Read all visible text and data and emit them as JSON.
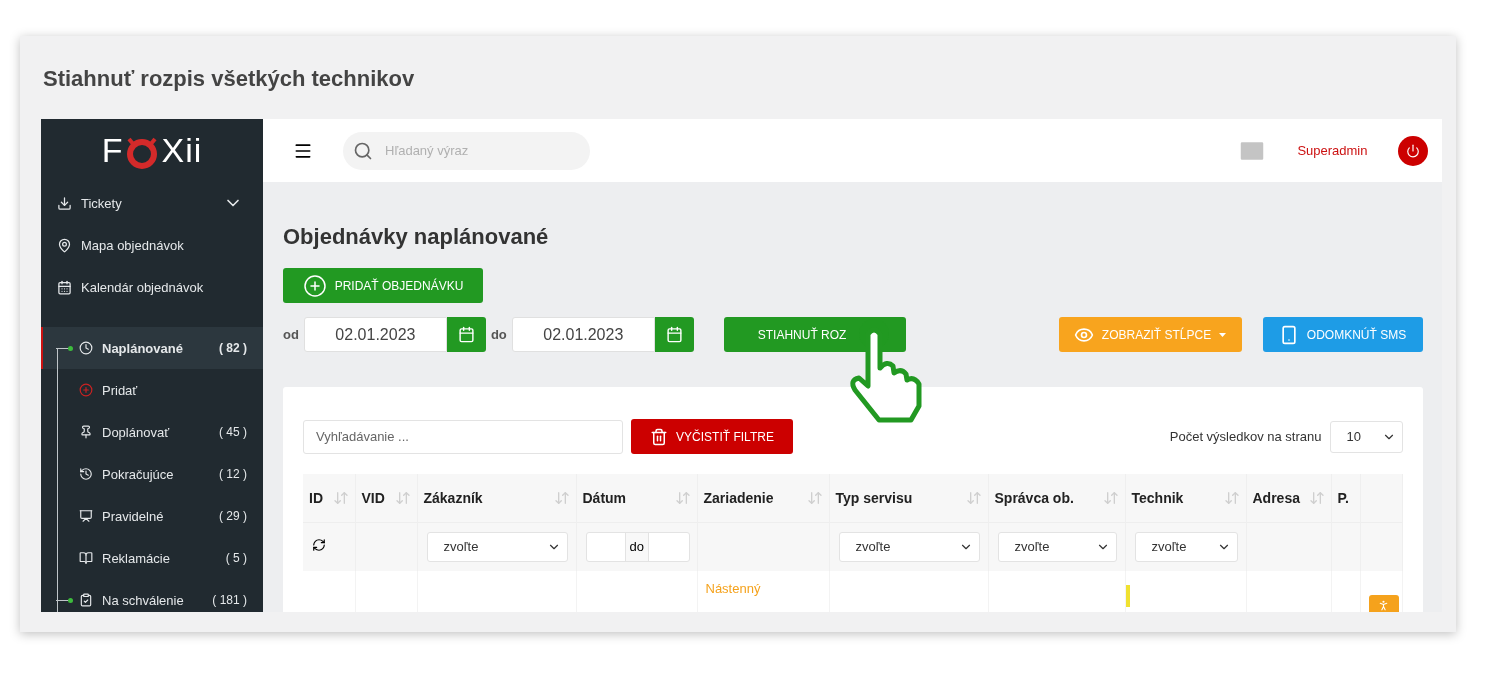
{
  "page_title": "Stiahnuť rozpis všetkých technikov",
  "logo": {
    "left": "F",
    "right": "Xii"
  },
  "sidebar": {
    "links": [
      {
        "label": "Tickety",
        "chevron": true
      },
      {
        "label": "Mapa objednávok",
        "chevron": false
      },
      {
        "label": "Kalendár objednávok",
        "chevron": false
      }
    ],
    "tree": [
      {
        "label": "Naplánované",
        "count": "( 82 )",
        "selected": true,
        "children": [
          {
            "label": "Pridať",
            "selected": false
          },
          {
            "label": "Doplánovať",
            "count": "( 45 )",
            "selected": false
          },
          {
            "label": "Pokračujúce",
            "count": "( 12 )",
            "selected": false
          },
          {
            "label": "Pravidelné",
            "count": "( 29 )",
            "selected": false
          },
          {
            "label": "Reklamácie",
            "count": "( 5 )",
            "selected": false
          }
        ]
      },
      {
        "label": "Na schválenie",
        "count": "( 181 )",
        "selected": false
      }
    ]
  },
  "topbar": {
    "search_placeholder": "Hľadaný výraz",
    "user": "Superadmin"
  },
  "heading": "Objednávky naplánované",
  "add_button": "PRIDAŤ OBJEDNÁVKU",
  "date_filter": {
    "from_label": "od",
    "from": "02.01.2023",
    "to_label": "do",
    "to": "02.01.2023"
  },
  "download_button": "STIAHNUŤ ROZ",
  "columns_button": "ZOBRAZIŤ STĹPCE",
  "sms_button": "ODOMKNÚŤ SMS",
  "table_search_placeholder": "Vyhľadávanie ...",
  "clear_button": "VYČISTIŤ FILTRE",
  "page_size": {
    "label": "Počet výsledkov na stranu",
    "value": "10"
  },
  "table": {
    "columns": [
      {
        "label": "ID",
        "sortable": true,
        "filter": {
          "kind": "refresh"
        }
      },
      {
        "label": "VID",
        "sortable": true,
        "filter": {
          "kind": "none"
        }
      },
      {
        "label": "Zákazník",
        "sortable": true,
        "filter": {
          "kind": "select",
          "placeholder": "zvoľte"
        }
      },
      {
        "label": "Dátum",
        "sortable": true,
        "filter": {
          "kind": "date_range",
          "between": "do"
        }
      },
      {
        "label": "Zariadenie",
        "sortable": true,
        "filter": {
          "kind": "none"
        }
      },
      {
        "label": "Typ servisu",
        "sortable": true,
        "filter": {
          "kind": "select",
          "placeholder": "zvoľte"
        }
      },
      {
        "label": "Správca ob.",
        "sortable": true,
        "filter": {
          "kind": "select",
          "placeholder": "zvoľte"
        }
      },
      {
        "label": "Technik",
        "sortable": true,
        "filter": {
          "kind": "select",
          "placeholder": "zvoľte"
        }
      },
      {
        "label": "Adresa",
        "sortable": true,
        "filter": {
          "kind": "none"
        }
      },
      {
        "label": "P.",
        "sortable": false,
        "filter": {
          "kind": "none"
        }
      }
    ],
    "rows": [
      {
        "cells": [
          {
            "kind": "empty"
          },
          {
            "kind": "empty"
          },
          {
            "kind": "empty"
          },
          {
            "kind": "empty"
          },
          {
            "kind": "text",
            "text": "Nástenný"
          },
          {
            "kind": "empty"
          },
          {
            "kind": "empty"
          },
          {
            "kind": "marker",
            "color": "#f0e130"
          },
          {
            "kind": "empty"
          },
          {
            "kind": "empty"
          },
          {
            "kind": "action"
          }
        ]
      }
    ]
  }
}
